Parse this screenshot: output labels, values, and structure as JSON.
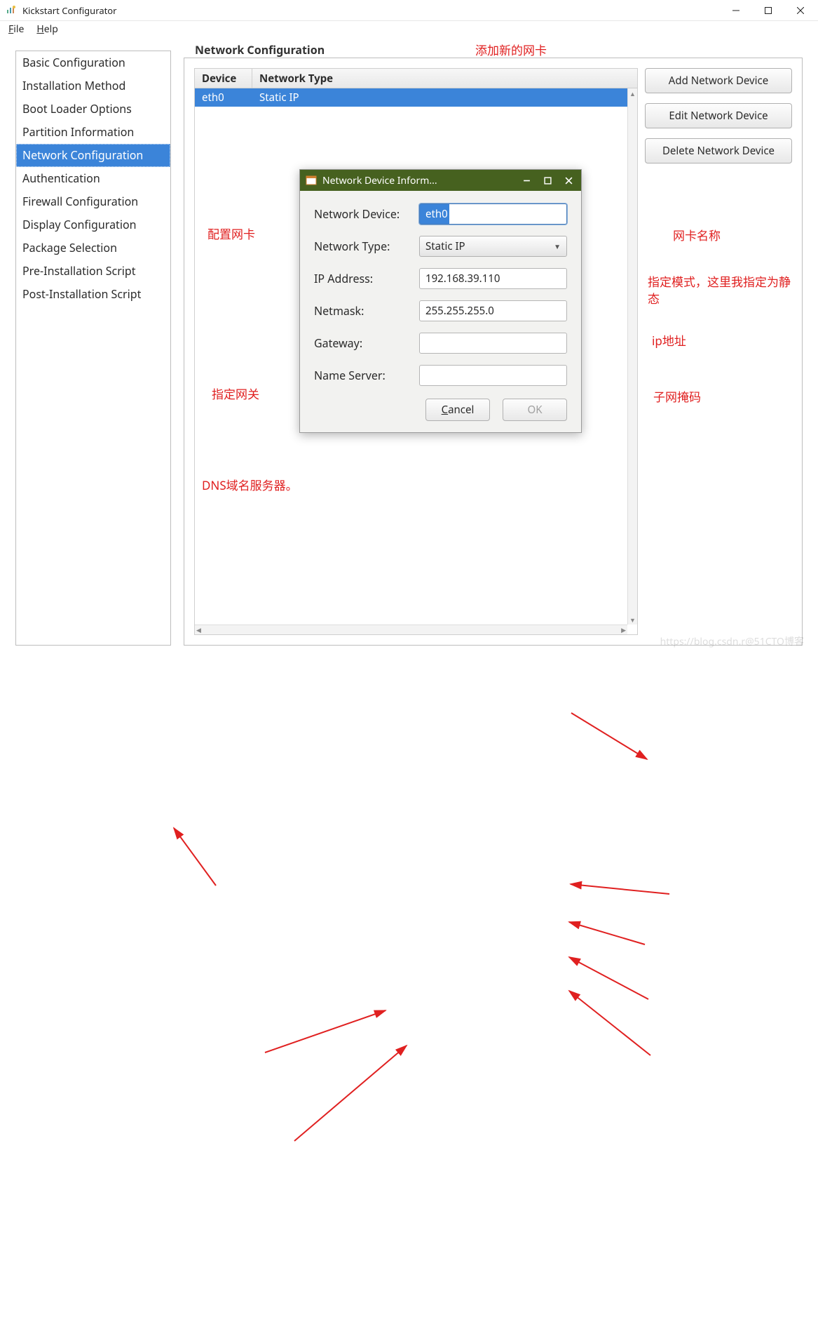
{
  "window": {
    "title": "Kickstart Configurator"
  },
  "menubar": {
    "file": "File",
    "file_hotkey": "F",
    "help": "Help",
    "help_hotkey": "H"
  },
  "sidebar": {
    "items": [
      {
        "label": "Basic Configuration"
      },
      {
        "label": "Installation Method"
      },
      {
        "label": "Boot Loader Options"
      },
      {
        "label": "Partition Information"
      },
      {
        "label": "Network Configuration"
      },
      {
        "label": "Authentication"
      },
      {
        "label": "Firewall Configuration"
      },
      {
        "label": "Display Configuration"
      },
      {
        "label": "Package Selection"
      },
      {
        "label": "Pre-Installation Script"
      },
      {
        "label": "Post-Installation Script"
      }
    ],
    "selected_index": 4
  },
  "panel": {
    "title": "Network Configuration",
    "columns": {
      "device": "Device",
      "type": "Network Type"
    },
    "rows": [
      {
        "device": "eth0",
        "type": "Static IP"
      }
    ],
    "buttons": {
      "add": "Add Network Device",
      "edit": "Edit Network Device",
      "delete": "Delete Network Device"
    }
  },
  "dialog": {
    "title": "Network Device Inform...",
    "fields": {
      "device_label": "Network Device:",
      "device_value": "eth0",
      "type_label": "Network Type:",
      "type_value": "Static IP",
      "ip_label": "IP Address:",
      "ip_value": "192.168.39.110",
      "netmask_label": "Netmask:",
      "netmask_value": "255.255.255.0",
      "gateway_label": "Gateway:",
      "gateway_value": "",
      "nameserver_label": "Name Server:",
      "nameserver_value": ""
    },
    "buttons": {
      "cancel": "Cancel",
      "cancel_hotkey": "C",
      "ok": "OK"
    }
  },
  "annotations": {
    "add_card": "添加新的网卡",
    "config_card": "配置网卡",
    "card_name": "网卡名称",
    "mode": "指定模式，这里我指定为静态",
    "ip": "ip地址",
    "subnet": "子网掩码",
    "gateway": "指定网关",
    "dns": "DNS域名服务器。"
  },
  "watermark": "https://blog.csdn.r@51CTO博客"
}
